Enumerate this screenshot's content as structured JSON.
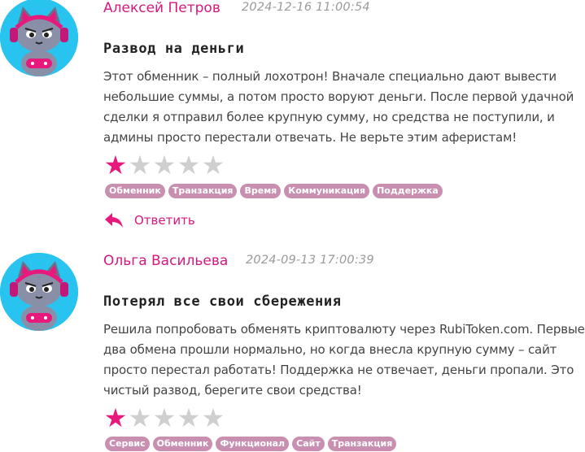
{
  "reviews": [
    {
      "author": "Алексей Петров",
      "date": "2024-12-16 11:00:54",
      "title": "Развод на деньги",
      "text": "Этот обменник – полный лохотрон! Вначале специально дают вывести небольшие суммы, а потом просто воруют деньги. После первой удачной сделки я отправил более крупную сумму, но средства не поступили, и админы просто перестали отвечать. Не верьте этим аферистам!",
      "rating": 1,
      "rating_max": 5,
      "tags": [
        "Обменник",
        "Транзакция",
        "Время",
        "Коммуникация",
        "Поддержка"
      ],
      "reply_label": "Ответить"
    },
    {
      "author": "Ольга Васильева",
      "date": "2024-09-13 17:00:39",
      "title": "Потерял все свои сбережения",
      "text": "Решила попробовать обменять криптовалюту через RubiToken.com. Первые два обмена прошли нормально, но когда внесла крупную сумму – сайт просто перестал работать! Поддержка не отвечает, деньги пропали. Это чистый развод, берегите свои средства!",
      "rating": 1,
      "rating_max": 5,
      "tags": [
        "Сервис",
        "Обменник",
        "Функционал",
        "Сайт",
        "Транзакция"
      ]
    }
  ],
  "colors": {
    "accent": "#d6187f",
    "star_on": "#e8197d",
    "star_off": "#cfcfcf",
    "tag_bg": "#c98fb0",
    "avatar_bg": "#29c3ef"
  },
  "icons": {
    "avatar": "cat-gamer-avatar-icon",
    "reply": "reply-arrow-icon",
    "star": "star-icon"
  }
}
